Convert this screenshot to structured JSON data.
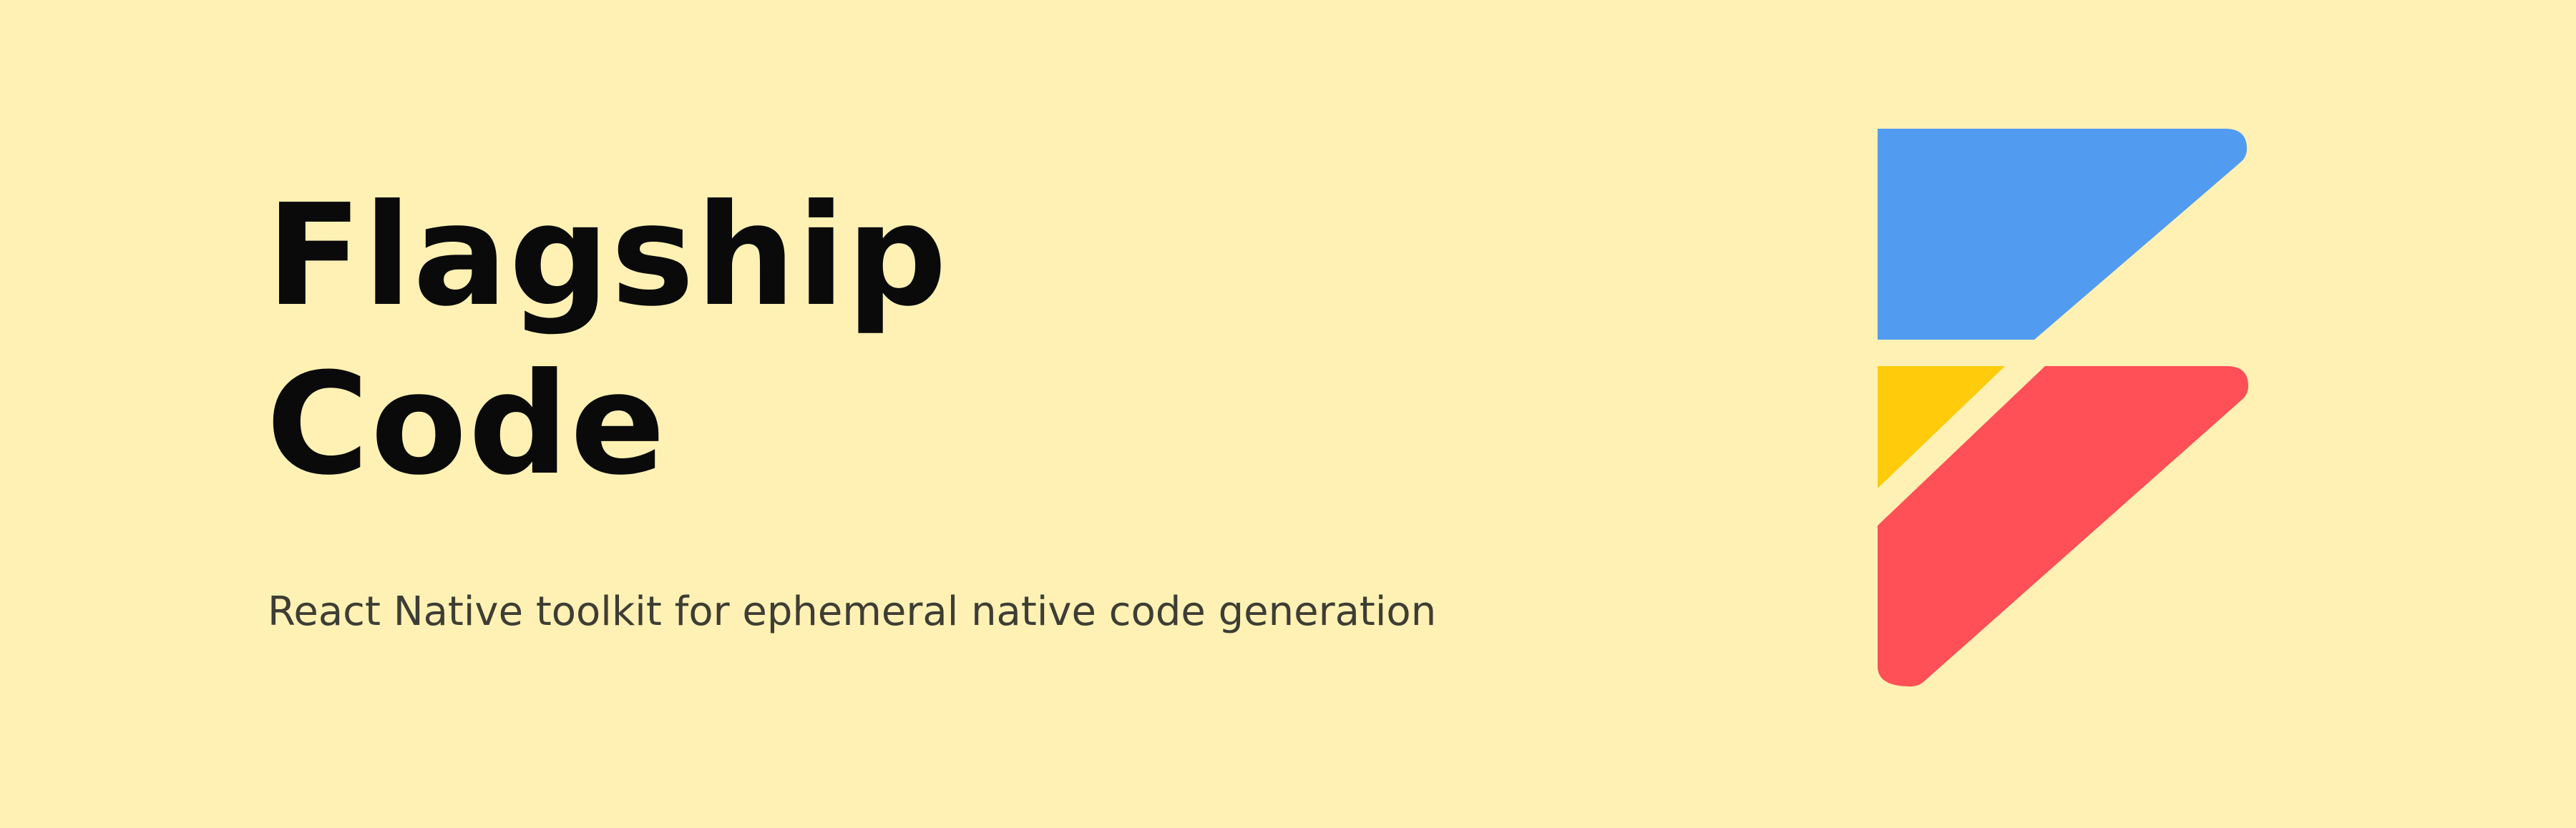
{
  "banner": {
    "title_line_1": "Flagship",
    "title_line_2": "Code",
    "subtitle": "React Native toolkit for ephemeral native code generation"
  },
  "logo": {
    "icon": "flagship-code-logo-icon",
    "colors": {
      "blue": "#519CF0",
      "yellow": "#FFCB0A",
      "red": "#FF4F57"
    }
  },
  "theme": {
    "background": "#FEF1B3",
    "title_color": "#0A0A0A",
    "subtitle_color": "#3E3D35"
  }
}
